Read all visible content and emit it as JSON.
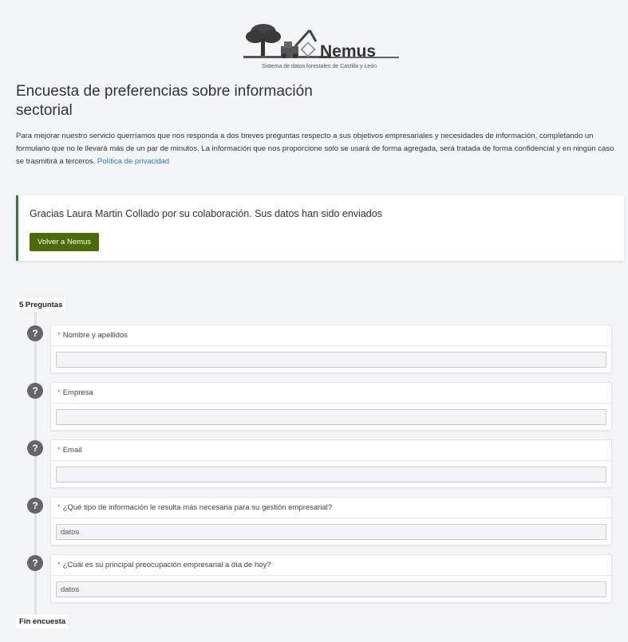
{
  "logo": {
    "name": "Nemus",
    "subtitle": "Sistema de datos forestales de Castilla y León"
  },
  "survey": {
    "title": "Encuesta de preferencias sobre información sectorial",
    "intro": "Para mejorar nuestro servicio querríamos que nos responda a dos breves preguntas respecto a sus objetivos empresariales y necesidades de información, completando un formulario que no le llevará más de un par de minutos. La información que nos proporcione solo se usará de forma agregada, será tratada de forma confidencial y en ningún caso se trasmitirá a terceros.",
    "privacy_link": "Política de privacidad"
  },
  "thanks": {
    "message": "Gracias Laura Martin Collado por su colaboración. Sus datos han sido enviados",
    "back_button": "Volver a Nemus"
  },
  "questions_badge": "5 Preguntas",
  "end_badge": "Fin encuesta",
  "required_mark": "*",
  "question_icon": "?",
  "questions": [
    {
      "label": "Nombre y apellidos",
      "value": ""
    },
    {
      "label": "Empresa",
      "value": ""
    },
    {
      "label": "Email",
      "value": ""
    },
    {
      "label": "¿Qué tipo de información le resulta más necesaria para su gestión empresarial?",
      "value": "datos"
    },
    {
      "label": "¿Cuál es su principal preocupación empresarial a día de hoy?",
      "value": "datos"
    }
  ],
  "colors": {
    "accent_green": "#4a6b06",
    "success_border": "#2e7d32",
    "link_blue": "#2a7bd0",
    "required_red": "#d9534f"
  }
}
